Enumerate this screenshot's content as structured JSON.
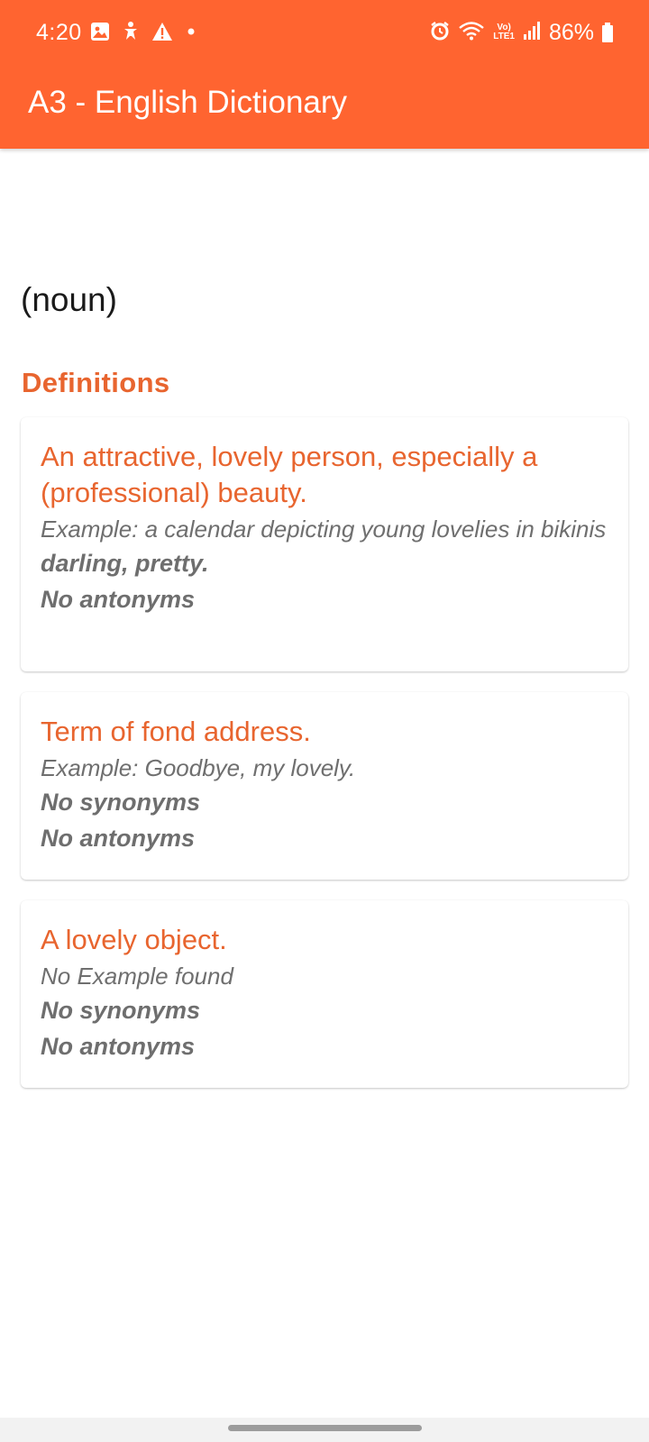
{
  "status_bar": {
    "time": "4:20",
    "battery": "86%",
    "network_label_top": "Vo)",
    "network_label_bottom": "LTE1",
    "left_icons": [
      "gallery-icon",
      "accessibility-icon",
      "warning-icon",
      "dot-icon"
    ],
    "right_icons": [
      "alarm-icon",
      "wifi-icon",
      "network-icon",
      "signal-icon",
      "battery-icon"
    ]
  },
  "app_bar": {
    "title": "A3 - English Dictionary",
    "color": "#FF6430"
  },
  "entry": {
    "part_of_speech": "(noun)",
    "section_title": "Definitions",
    "accent_color": "#E8652F"
  },
  "definitions": [
    {
      "definition": "An attractive, lovely person, especially a (professional) beauty.",
      "example": "Example: a calendar depicting young lovelies in bikinis",
      "synonyms": "darling, pretty.",
      "antonyms": "No antonyms"
    },
    {
      "definition": "Term of fond address.",
      "example": "Example: Goodbye, my lovely.",
      "synonyms": "No synonyms",
      "antonyms": "No antonyms"
    },
    {
      "definition": "A lovely object.",
      "example": "No Example found",
      "synonyms": "No synonyms",
      "antonyms": "No antonyms"
    }
  ]
}
